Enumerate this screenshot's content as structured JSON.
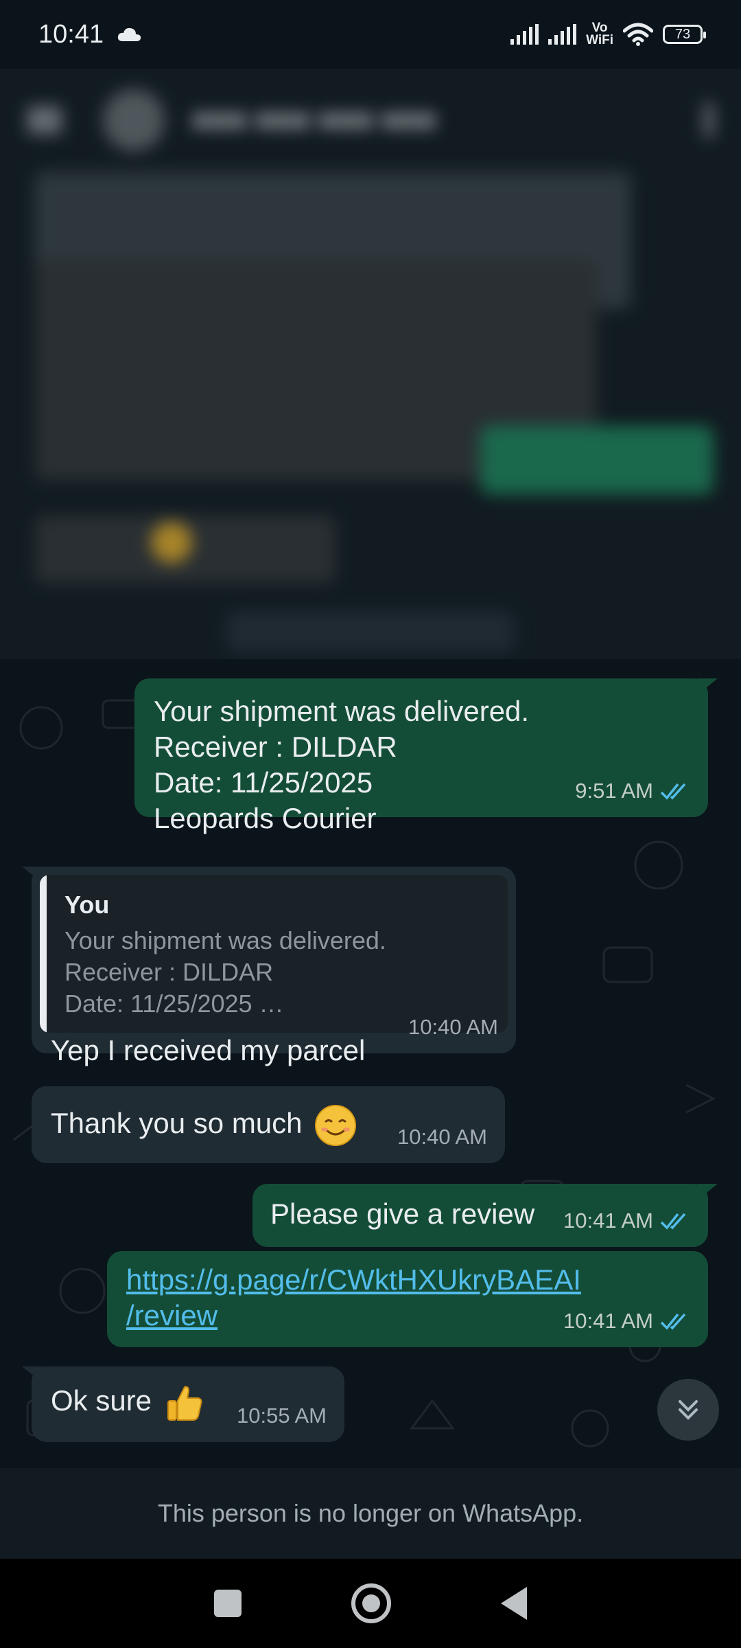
{
  "status_bar": {
    "time": "10:41",
    "vowifi_top": "Vo",
    "vowifi_bottom": "WiFi",
    "battery": "73",
    "icons": [
      "cloud-icon",
      "signal-icon",
      "signal-icon",
      "wifi-icon",
      "battery-icon"
    ]
  },
  "messages": [
    {
      "direction": "out",
      "lines": [
        "Your shipment was delivered.",
        "Receiver : DILDAR",
        "Date: 11/25/2025",
        "Leopards Courier"
      ],
      "time": "9:51 AM",
      "status": "read"
    },
    {
      "direction": "in",
      "quote": {
        "author": "You",
        "lines": [
          "Your shipment was delivered.",
          "Receiver : DILDAR",
          "Date: 11/25/2025 …"
        ]
      },
      "text": "Yep I received my parcel",
      "time": "10:40 AM"
    },
    {
      "direction": "in",
      "text": "Thank you so much",
      "emoji": "smiling-face-icon",
      "time": "10:40 AM"
    },
    {
      "direction": "out",
      "text": "Please give a review",
      "time": "10:41 AM",
      "status": "read"
    },
    {
      "direction": "out",
      "link_lines": [
        "https://g.page/r/CWktHXUkryBAEAI",
        "/review"
      ],
      "time": "10:41 AM",
      "status": "read"
    },
    {
      "direction": "in",
      "text": "Ok sure",
      "emoji": "thumbs-up-icon",
      "time": "10:55 AM"
    }
  ],
  "notice": "This person is no longer on WhatsApp.",
  "colors": {
    "outgoing_bubble": "#144d37",
    "incoming_bubble": "#202c33",
    "read_ticks": "#53bdeb",
    "link": "#53bdeb",
    "background": "#0b141a"
  }
}
